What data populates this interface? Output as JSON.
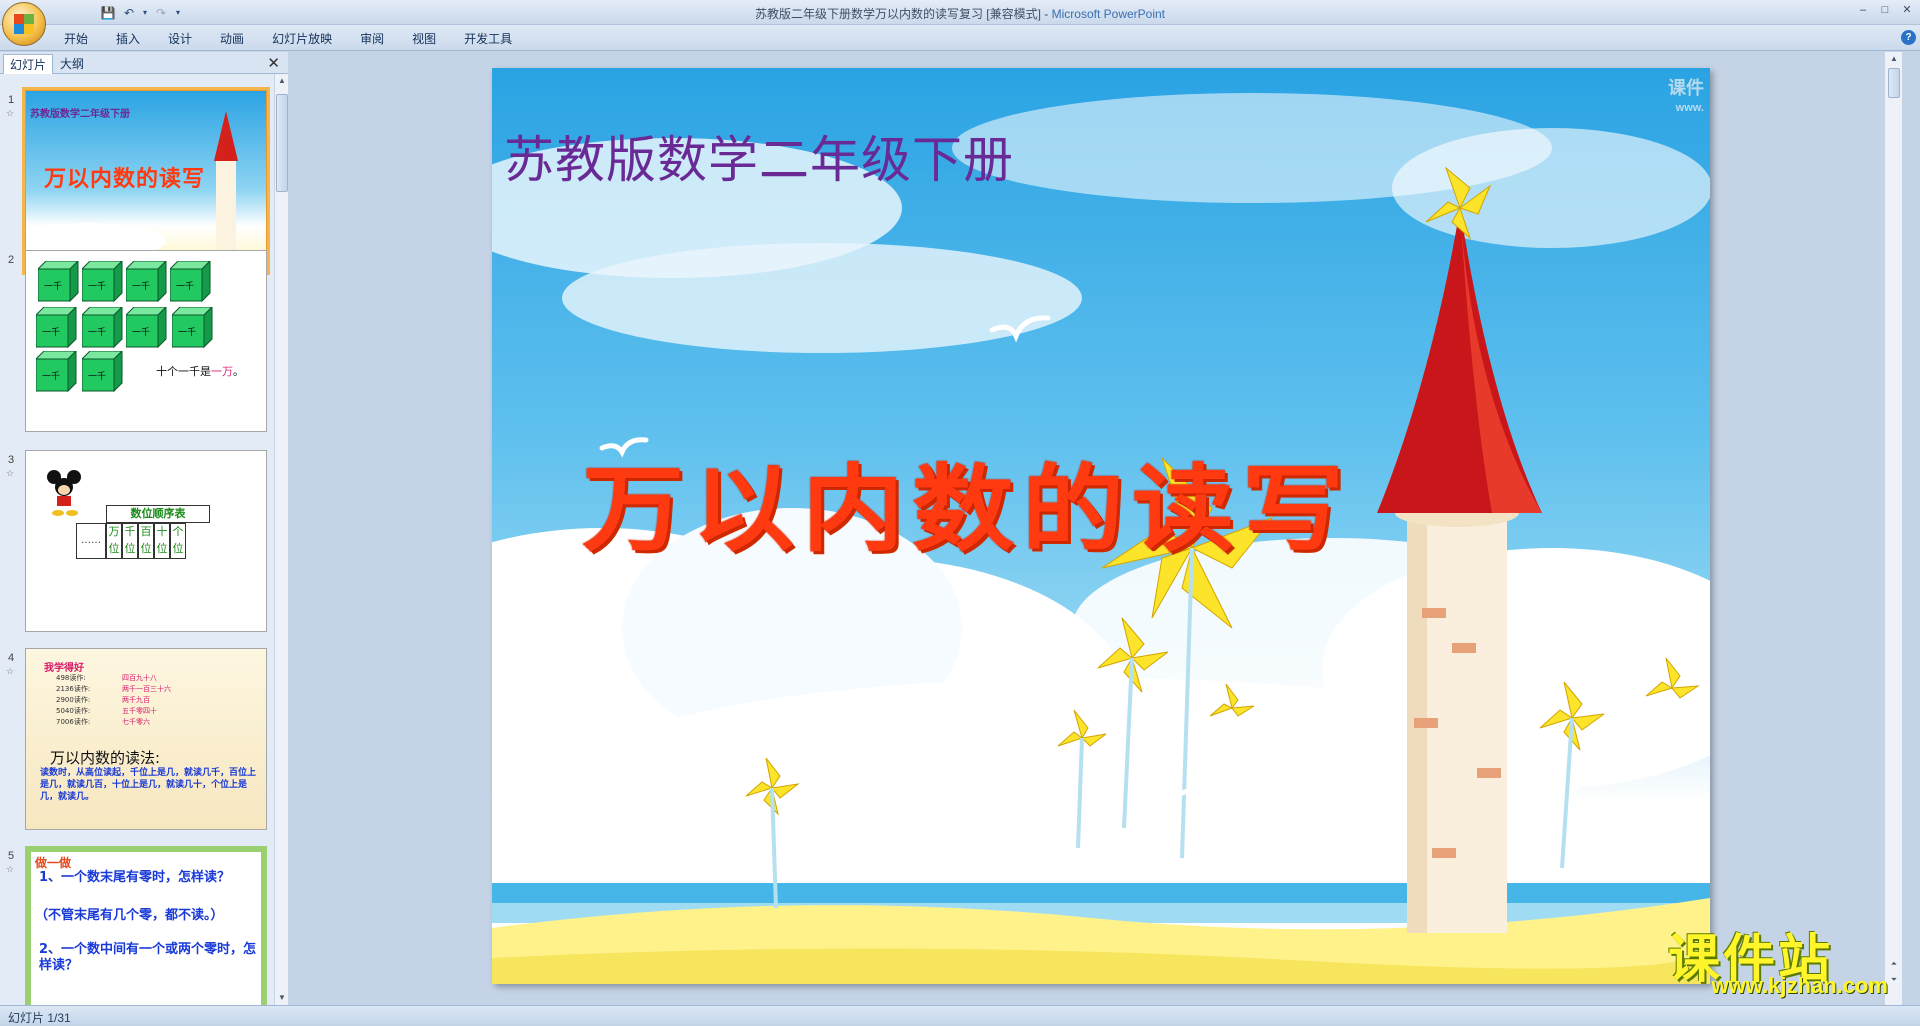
{
  "window": {
    "title": "苏教版二年级下册数学万以内数的读写复习 [兼容模式] - ",
    "app_name": "Microsoft PowerPoint",
    "minimize": "–",
    "maximize": "□",
    "close": "✕"
  },
  "quick_access": {
    "save": "💾",
    "undo": "↶",
    "undo_arrow": "▾",
    "redo": "↷",
    "customize": "▾"
  },
  "ribbon": {
    "tabs": [
      "开始",
      "插入",
      "设计",
      "动画",
      "幻灯片放映",
      "审阅",
      "视图",
      "开发工具"
    ],
    "help": "?"
  },
  "left_panel": {
    "tab_slides": "幻灯片",
    "tab_outline": "大纲",
    "close": "✕"
  },
  "thumbnails": [
    {
      "num": "1",
      "subtitle": "苏教版数学二年级下册",
      "title": "万以内数的读写"
    },
    {
      "num": "2",
      "cube_label": "一千",
      "caption_prefix": "十个一千是",
      "caption_highlight": "一万",
      "caption_suffix": "。"
    },
    {
      "num": "3",
      "table_title": "数位顺序表",
      "ellipsis": "……",
      "cols": [
        "万位",
        "千位",
        "百位",
        "十位",
        "个位"
      ]
    },
    {
      "num": "4",
      "heading": "我学得好",
      "rows": [
        {
          "n": "498读作:",
          "v": "四百九十八"
        },
        {
          "n": "2136读作:",
          "v": "两千一百三十六"
        },
        {
          "n": "2900读作:",
          "v": "两千九百"
        },
        {
          "n": "5040读作:",
          "v": "五千零四十"
        },
        {
          "n": "7006读作:",
          "v": "七千零六"
        }
      ],
      "rule_title": "万以内数的读法:",
      "rule_text": "读数时，从高位读起，千位上是几，就读几千，百位上是几，就读几百，十位上是几，就读几十，个位上是几，就读几。"
    },
    {
      "num": "5",
      "heading": "做一做",
      "q1": "1、一个数末尾有零时，怎样读？",
      "a1": "（不管末尾有几个零，都不读。）",
      "q2": "2、一个数中间有一个或两个零时，怎样读？"
    }
  ],
  "slide": {
    "subtitle": "苏教版数学二年级下册",
    "title": "万以内数的读写",
    "corner_mark": "课件",
    "corner_url": "www.",
    "watermark_top": "课件站",
    "watermark_url": "www.kjzhan.com"
  },
  "status": {
    "text": "幻灯片 1/31"
  },
  "colors": {
    "accent": "#f4b54c",
    "title_red": "#ff3a10",
    "subtitle_purple": "#6a2a96",
    "cube_green": "#22c860"
  }
}
